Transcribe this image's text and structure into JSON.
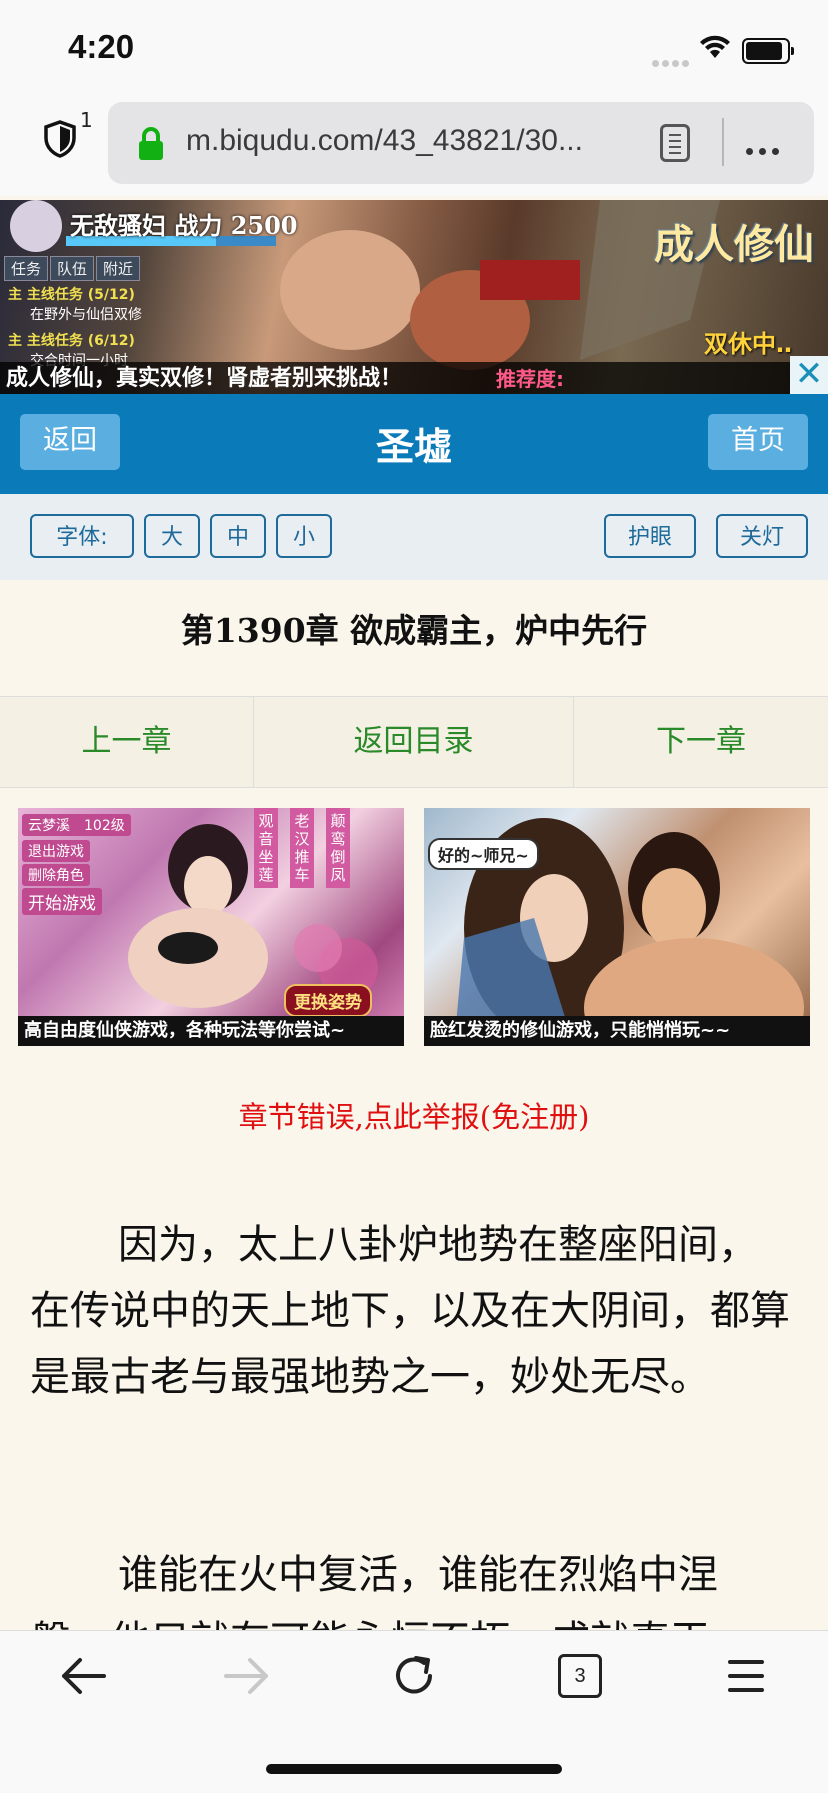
{
  "status_bar": {
    "time": "4:20"
  },
  "browser": {
    "tracker_count": "1",
    "url": "m.biqudu.com/43_43821/30...",
    "open_tabs": "3"
  },
  "banner_ad": {
    "game_title": "无敌骚妇 战力 2500",
    "tabs": [
      "任务",
      "队伍",
      "附近"
    ],
    "quests": [
      "主 主线任务 (5/12)",
      "在野外与仙侣双修",
      "主 主线任务 (6/12)",
      "交合时间一小时"
    ],
    "brand": "成人修仙",
    "status": "双休中‥",
    "slogan": "成人修仙，真实双修！肾虚者别来挑战！",
    "recommend": "推荐度:",
    "close_icon": "✕"
  },
  "header": {
    "back_label": "返回",
    "title": "圣墟",
    "home_label": "首页"
  },
  "toolbar": {
    "font_label": "字体:",
    "font_large": "大",
    "font_medium": "中",
    "font_small": "小",
    "eye_care": "护眼",
    "lights_off": "关灯"
  },
  "chapter": {
    "title": "第1390章 欲成霸主，炉中先行",
    "prev": "上一章",
    "toc": "返回目录",
    "next": "下一章",
    "report": "章节错误,点此举报(免注册)",
    "paragraphs": [
      "因为，太上八卦炉地势在整座阳间，在传说中的天上地下，以及在大阴间，都算是最古老与最强地势之一，妙处无尽。",
      "谁能在火中复活，谁能在烈焰中涅槃，他只就有可能永恒不朽，成就真王。"
    ]
  },
  "ad_left": {
    "menu": [
      "云梦溪　102级",
      "退出游戏",
      "删除角色",
      "开始游戏"
    ],
    "vertical": [
      "观音坐莲",
      "老汉推车",
      "颠鸾倒凤"
    ],
    "swap": "更换姿势",
    "caption": "高自由度仙侠游戏，各种玩法等你尝试~"
  },
  "ad_right": {
    "bubble": "好的~师兄~",
    "caption": "脸红发烫的修仙游戏，只能悄悄玩~~"
  }
}
